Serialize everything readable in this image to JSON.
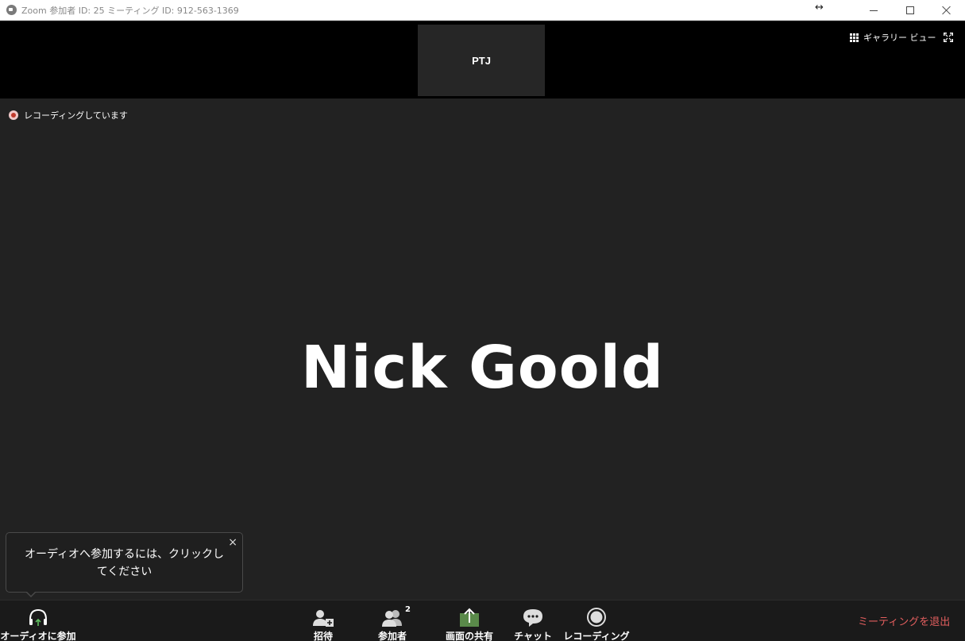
{
  "window": {
    "title": "Zoom 参加者 ID: 25 ミーティング ID: 912-563-1369",
    "resize_icon": "↔"
  },
  "top_strip": {
    "thumbnail_name": "PTJ",
    "gallery_view_label": "ギャラリー ビュー"
  },
  "main": {
    "recording_status": "レコーディングしています",
    "active_speaker": "Nick Goold"
  },
  "tooltip": {
    "text": "オーディオへ参加するには、クリックしてください",
    "close": "×"
  },
  "toolbar": {
    "audio_label": "オーディオに参加",
    "invite_label": "招待",
    "participants_label": "参加者",
    "participants_count": "2",
    "share_label": "画面の共有",
    "chat_label": "チャット",
    "record_label": "レコーディング",
    "leave_label": "ミーティングを退出"
  },
  "colors": {
    "background": "#222222",
    "toolbar": "#1a1a1a",
    "leave": "#e25e5e",
    "share_icon": "#5a8a4a",
    "recording_dot": "#c0392b"
  },
  "icons": [
    "zoom-logo-icon",
    "resize-icon",
    "minimize-icon",
    "maximize-icon",
    "close-icon",
    "gallery-grid-icon",
    "fullscreen-icon",
    "recording-dot-icon",
    "headphones-icon",
    "invite-icon",
    "participants-icon",
    "share-screen-icon",
    "chat-icon",
    "record-icon"
  ]
}
